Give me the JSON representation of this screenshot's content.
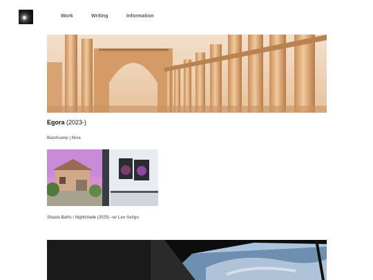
{
  "nav": {
    "work": "Work",
    "writing": "Writing",
    "information": "Information"
  },
  "project": {
    "title_bold": "Egora",
    "title_year": "(2023-)",
    "link_bandcamp": "Bandcamp",
    "separator": "|",
    "link_nina": "Nina"
  },
  "item2": {
    "title_a": "Shasta Baths",
    "slash": "/",
    "title_b": "Nightshade",
    "year": "(2025) –w/",
    "collaborator": "Leo Seligo"
  },
  "colors": {
    "nav_text": "#555555",
    "muted_text": "#777777",
    "background": "#ffffff"
  }
}
